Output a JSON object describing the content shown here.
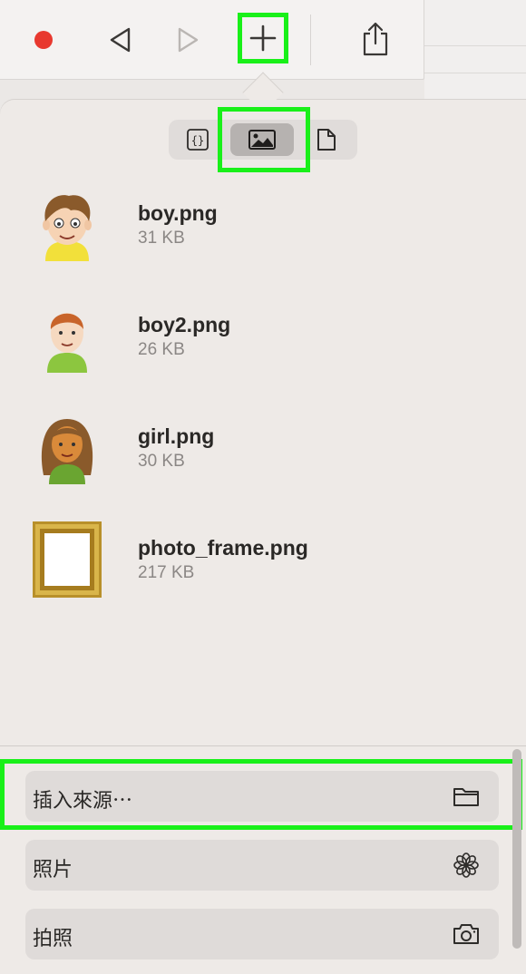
{
  "colors": {
    "highlight": "#19f019",
    "record": "#e8392f"
  },
  "toolbar": {
    "icons": [
      "record-icon",
      "back-icon",
      "forward-icon",
      "plus-icon",
      "share-icon"
    ]
  },
  "tabs": [
    "code-icon",
    "image-icon",
    "document-icon"
  ],
  "files": [
    {
      "name": "boy.png",
      "size": "31 KB",
      "thumb": "boy-thumbnail"
    },
    {
      "name": "boy2.png",
      "size": "26 KB",
      "thumb": "boy2-thumbnail"
    },
    {
      "name": "girl.png",
      "size": "30 KB",
      "thumb": "girl-thumbnail"
    },
    {
      "name": "photo_frame.png",
      "size": "217 KB",
      "thumb": "photo-frame-thumbnail"
    }
  ],
  "actions": [
    {
      "label": "插入來源⋯",
      "icon": "folder-icon"
    },
    {
      "label": "照片",
      "icon": "flower-icon"
    },
    {
      "label": "拍照",
      "icon": "camera-icon"
    }
  ]
}
